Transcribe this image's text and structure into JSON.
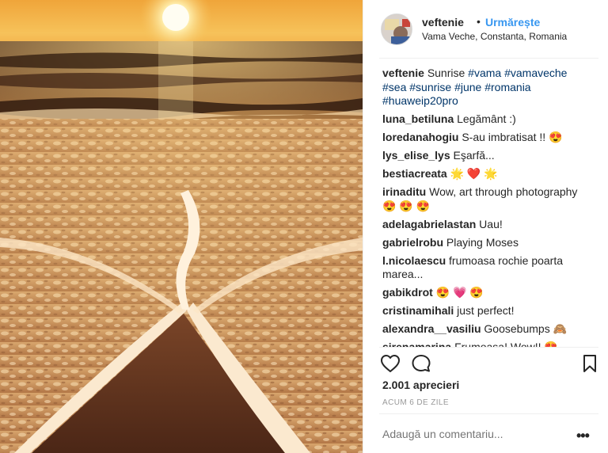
{
  "post": {
    "username": "veftenie",
    "separator": "•",
    "follow_label": "Urmărește",
    "location": "Vama Veche, Constanta, Romania",
    "caption": {
      "username": "veftenie",
      "text": "Sunrise",
      "tags": [
        "#vama",
        "#vamaveche",
        "#sea",
        "#sunrise",
        "#june",
        "#romania",
        "#huaweip20pro"
      ]
    },
    "comments": [
      {
        "user": "luna_betiluna",
        "text": "Legământ :)"
      },
      {
        "user": "loredanahogiu",
        "text": "S-au imbratisat !! 😍"
      },
      {
        "user": "lys_elise_lys",
        "text": "Eşarfă..."
      },
      {
        "user": "bestiacreata",
        "text": "🌟 ❤️ 🌟"
      },
      {
        "user": "irinaditu",
        "text": "Wow, art through photography 😍 😍 😍"
      },
      {
        "user": "adelagabrielastan",
        "text": "Uau!"
      },
      {
        "user": "gabrielrobu",
        "text": "Playing Moses"
      },
      {
        "user": "l.nicolaescu",
        "text": "frumoasa rochie poarta marea..."
      },
      {
        "user": "gabikdrot",
        "text": "😍 💗 😍"
      },
      {
        "user": "cristinamihali",
        "text": "just perfect!"
      },
      {
        "user": "alexandra__vasiliu",
        "text": "Goosebumps 🙈"
      },
      {
        "user": "sirenamarina",
        "text": "Frumoasa! Wow!! 😍"
      }
    ],
    "likes_label": "2.001 aprecieri",
    "time_label": "ACUM 6 DE ZILE",
    "comment_placeholder": "Adaugă un comentariu...",
    "more_label": "•••"
  },
  "icons": {
    "like": "heart-icon",
    "comment": "comment-bubble-icon",
    "save": "bookmark-icon"
  },
  "colors": {
    "follow": "#3897f0",
    "hashtag": "#003569",
    "muted": "#999999",
    "text": "#262626"
  }
}
